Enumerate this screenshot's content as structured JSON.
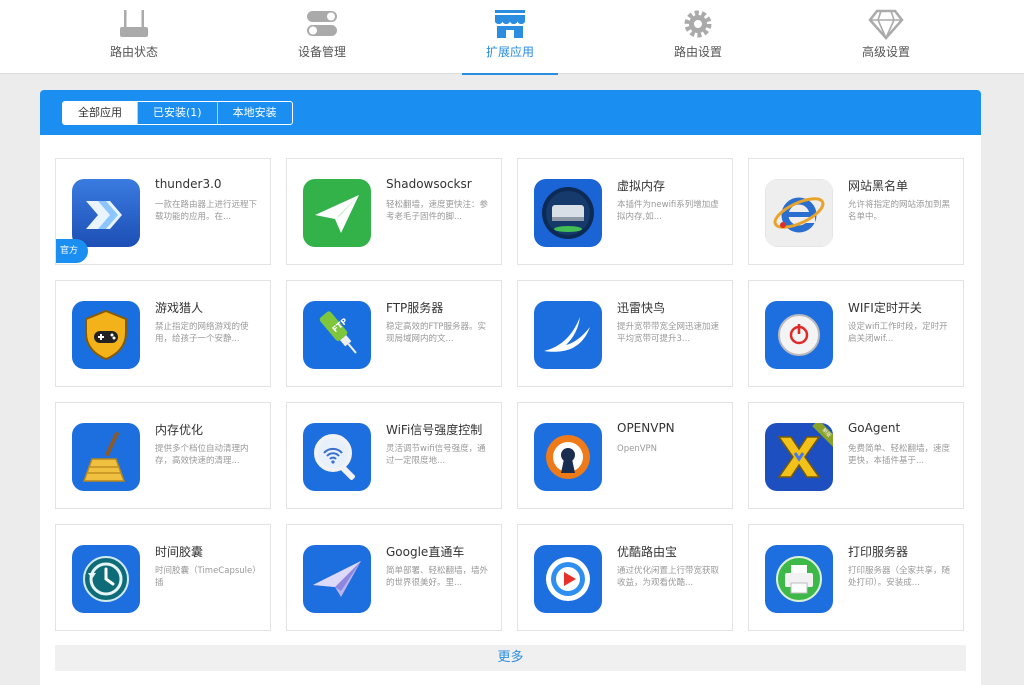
{
  "nav": {
    "items": [
      {
        "label": "路由状态",
        "icon": "router-icon"
      },
      {
        "label": "设备管理",
        "icon": "toggle-switch-icon"
      },
      {
        "label": "扩展应用",
        "icon": "store-icon",
        "active": true
      },
      {
        "label": "路由设置",
        "icon": "gear-icon"
      },
      {
        "label": "高级设置",
        "icon": "diamond-icon"
      }
    ]
  },
  "tabs": [
    {
      "label": "全部应用",
      "active": true
    },
    {
      "label": "已安装(1)"
    },
    {
      "label": "本地安装"
    }
  ],
  "official_badge": "官方",
  "apps": [
    {
      "name": "thunder3.0",
      "desc": "一款在路由器上进行远程下载功能的应用。在...",
      "icon": "thunder-arrow-icon"
    },
    {
      "name": "Shadowsocksr",
      "desc": "轻松翻墙，速度更快注：参考老毛子固件的脚...",
      "icon": "paper-plane-icon"
    },
    {
      "name": "虚拟内存",
      "desc": "本插件为newifi系列增加虚拟内存,如...",
      "icon": "hard-drive-icon"
    },
    {
      "name": "网站黑名单",
      "desc": "允许将指定的网站添加到黑名单中。",
      "icon": "ie-browser-icon"
    },
    {
      "name": "游戏猎人",
      "desc": "禁止指定的网络游戏的使用，给孩子一个安静...",
      "icon": "gamepad-shield-icon"
    },
    {
      "name": "FTP服务器",
      "desc": "稳定高效的FTP服务器。实现局域网内的文...",
      "icon": "ftp-usb-icon"
    },
    {
      "name": "迅雷快鸟",
      "desc": "提升宽带带宽全网迅速加速平均宽带可提升3...",
      "icon": "swallow-bird-icon"
    },
    {
      "name": "WIFI定时开关",
      "desc": "设定wifi工作时段，定时开启关闭wif...",
      "icon": "power-button-icon"
    },
    {
      "name": "内存优化",
      "desc": "提供多个档位自动清理内存，高效快速的清理...",
      "icon": "broom-icon"
    },
    {
      "name": "WiFi信号强度控制",
      "desc": "灵活调节wifi信号强度，通过一定限度地...",
      "icon": "wifi-magnifier-icon"
    },
    {
      "name": "OPENVPN",
      "desc": "OpenVPN",
      "icon": "openvpn-icon"
    },
    {
      "name": "GoAgent",
      "desc": "免费简单、轻松翻墙，速度更快，本插件基于...",
      "icon": "goagent-x-icon",
      "ribbon": "新版"
    },
    {
      "name": "时间胶囊",
      "desc": "时间胶囊（TimeCapsule）插",
      "icon": "time-clock-icon"
    },
    {
      "name": "Google直通车",
      "desc": "简单部署、轻松翻墙，墙外的世界很美好。里...",
      "icon": "paper-plane-purple-icon"
    },
    {
      "name": "优酷路由宝",
      "desc": "通过优化闲置上行带宽获取收益，为观看优酷...",
      "icon": "play-button-icon"
    },
    {
      "name": "打印服务器",
      "desc": "打印服务器（全家共享，随处打印）。安装成...",
      "icon": "printer-icon"
    }
  ],
  "more_label": "更多",
  "colors": {
    "primary": "#1b8ef2",
    "active_nav": "#2a8de0"
  }
}
